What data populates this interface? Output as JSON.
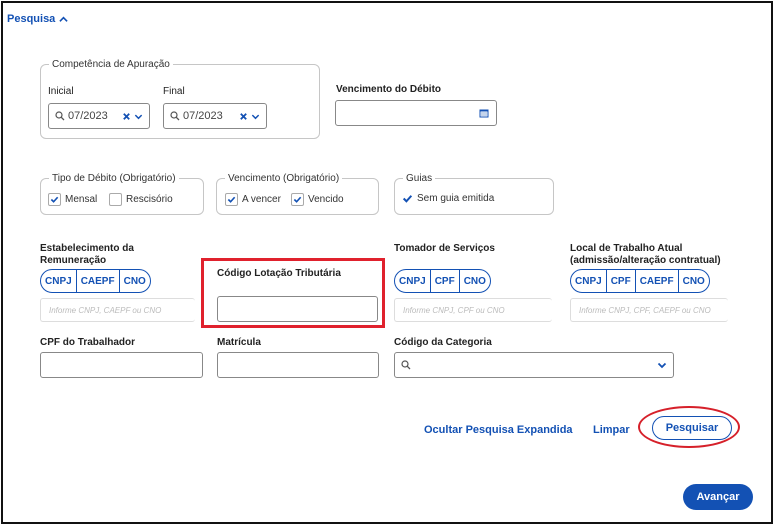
{
  "header": {
    "toggle_label": "Pesquisa"
  },
  "competencia": {
    "legend": "Competência de Apuração",
    "inicial_label": "Inicial",
    "inicial_value": "07/2023",
    "final_label": "Final",
    "final_value": "07/2023"
  },
  "vencimento_debito": {
    "label": "Vencimento do Débito",
    "value": ""
  },
  "tipo_debito": {
    "legend": "Tipo de Débito (Obrigatório)",
    "options": [
      {
        "label": "Mensal",
        "checked": true
      },
      {
        "label": "Rescisório",
        "checked": false
      }
    ]
  },
  "vencimento": {
    "legend": "Vencimento (Obrigatório)",
    "options": [
      {
        "label": "A vencer",
        "checked": true
      },
      {
        "label": "Vencido",
        "checked": true
      }
    ]
  },
  "guias": {
    "legend": "Guias",
    "option": {
      "label": "Sem guia emitida",
      "checked": true
    }
  },
  "estabelecimento": {
    "label_line1": "Estabelecimento da",
    "label_line2": "Remuneração",
    "segments": [
      "CNPJ",
      "CAEPF",
      "CNO"
    ],
    "placeholder": "Informe CNPJ, CAEPF ou CNO"
  },
  "codigo_lotacao": {
    "label": "Código Lotação Tributária",
    "value": ""
  },
  "tomador": {
    "label": "Tomador de Serviços",
    "segments": [
      "CNPJ",
      "CPF",
      "CNO"
    ],
    "placeholder": "Informe CNPJ, CPF ou CNO"
  },
  "local_trabalho": {
    "label_line1": "Local de Trabalho Atual",
    "label_line2": "(admissão/alteração contratual)",
    "segments": [
      "CNPJ",
      "CPF",
      "CAEPF",
      "CNO"
    ],
    "placeholder": "Informe CNPJ, CPF, CAEPF ou CNO"
  },
  "cpf_trabalhador": {
    "label": "CPF do Trabalhador",
    "value": ""
  },
  "matricula": {
    "label": "Matrícula",
    "value": ""
  },
  "codigo_categoria": {
    "label": "Código da Categoria",
    "value": ""
  },
  "actions": {
    "ocultar": "Ocultar Pesquisa Expandida",
    "limpar": "Limpar",
    "pesquisar": "Pesquisar",
    "avancar": "Avançar"
  },
  "colors": {
    "primary": "#1351b4",
    "highlight_red": "#e0212d"
  },
  "icons": {
    "toggle": "chevron-up-icon",
    "search": "search-icon",
    "clear": "close-icon",
    "dropdown": "chevron-down-icon",
    "calendar": "calendar-icon",
    "check": "check-icon"
  }
}
